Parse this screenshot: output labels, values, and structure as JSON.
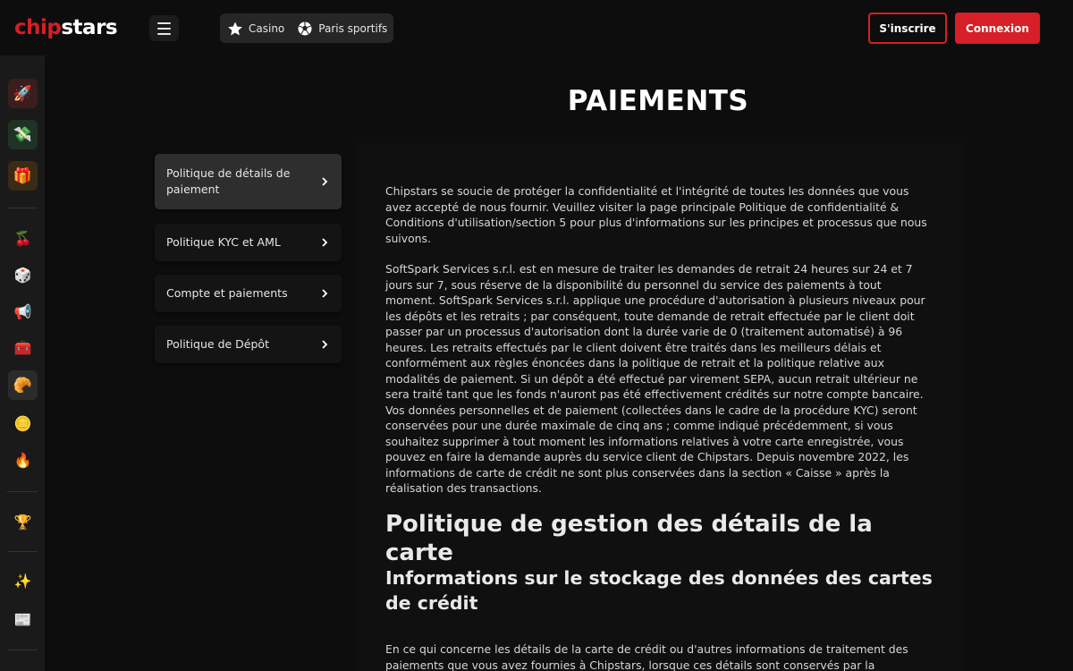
{
  "header": {
    "logo": {
      "part1": "chip",
      "part2": "stars"
    },
    "nav": [
      {
        "label": "Casino",
        "icon": "star-icon"
      },
      {
        "label": "Paris sportifs",
        "icon": "soccer-ball-icon"
      }
    ],
    "register_label": "S'inscrire",
    "login_label": "Connexion"
  },
  "colors": {
    "brand_red": "#d61f26",
    "background": "#0d0d0d",
    "sidebar": "#1a1a1a"
  },
  "sidebar": {
    "icons": [
      "rocket-icon",
      "money-icon",
      "gift-icon",
      "cherries-icon",
      "dice-icon",
      "megaphone-icon",
      "treasure-chest-icon",
      "croissant-icon",
      "coin-icon",
      "flame-icon",
      "trophy-icon",
      "sparkle-icon",
      "newspaper-icon"
    ]
  },
  "page": {
    "title": "PAIEMENTS"
  },
  "side_menu": [
    {
      "label": "Politique de détails de paiement",
      "active": true
    },
    {
      "label": "Politique KYC et AML",
      "active": false
    },
    {
      "label": "Compte et paiements",
      "active": false
    },
    {
      "label": "Politique de Dépôt",
      "active": false
    }
  ],
  "content": {
    "para1": "Chipstars se soucie de protéger la confidentialité et l'intégrité de toutes les données que vous avez accepté de nous fournir. Veuillez visiter la page principale Politique de confidentialité & Conditions d'utilisation/section 5 pour plus d'informations sur les principes et processus que nous suivons.",
    "para2": "SoftSpark Services s.r.l. est en mesure de traiter les demandes de retrait 24 heures sur 24 et 7 jours sur 7, sous réserve de la disponibilité du personnel du service des paiements à tout moment. SoftSpark Services s.r.l. applique une procédure d'autorisation à plusieurs niveaux pour les dépôts et les retraits ; par conséquent, toute demande de retrait effectuée par le client doit passer par un processus d'autorisation dont la durée varie de 0 (traitement automatisé) à 96 heures. Les retraits effectués par le client doivent être traités dans les meilleurs délais et conformément aux règles énoncées dans la politique de retrait et la politique relative aux modalités de paiement. Si un dépôt a été effectué par virement SEPA, aucun retrait ultérieur ne sera traité tant que les fonds n'auront pas été effectivement crédités sur notre compte bancaire. Vos données personnelles et de paiement (collectées dans le cadre de la procédure KYC) seront conservées pour une durée maximale de cinq ans ; comme indiqué précédemment, si vous souhaitez supprimer à tout moment les informations relatives à votre carte enregistrée, vous pouvez en faire la demande auprès du service client de Chipstars. Depuis novembre 2022, les informations de carte de crédit ne sont plus conservées dans la section « Caisse » après la réalisation des transactions.",
    "heading1": "Politique de gestion des détails de la carte",
    "heading2": "Informations sur le stockage des données des cartes de crédit",
    "para3": "En ce qui concerne les détails de la carte de crédit ou d'autres informations de traitement des paiements que vous avez fournies à Chipstars, lorsque ces détails sont conservés par la plateforme"
  }
}
